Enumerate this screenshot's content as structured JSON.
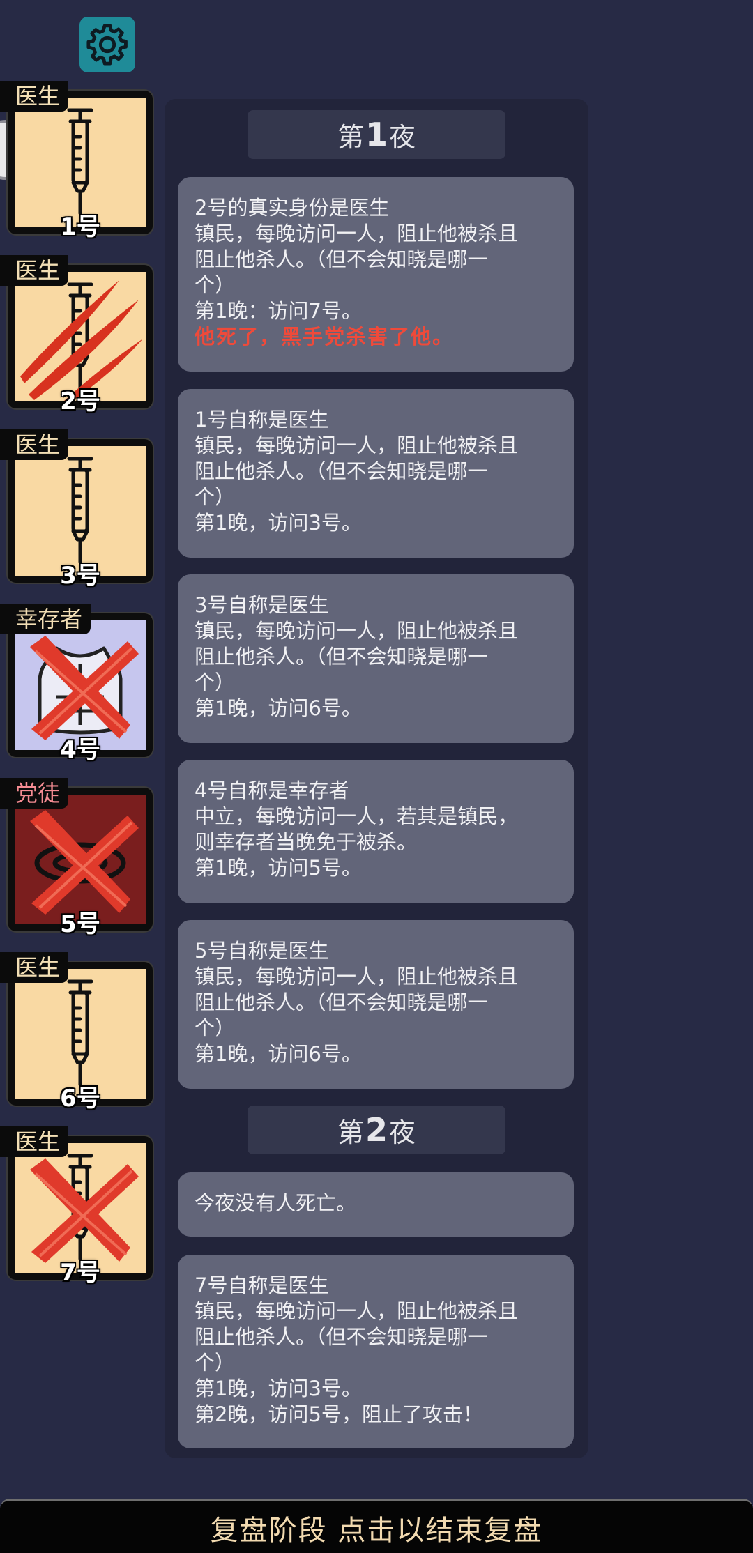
{
  "players": [
    {
      "role": "医生",
      "number": "1号",
      "icon": "syringe-icon",
      "state": "alive",
      "card_color": "#f9d9a3",
      "role_color": "#f3dfb5"
    },
    {
      "role": "医生",
      "number": "2号",
      "icon": "syringe-icon",
      "state": "clawed",
      "card_color": "#f9d9a3",
      "role_color": "#f3dfb5"
    },
    {
      "role": "医生",
      "number": "3号",
      "icon": "syringe-icon",
      "state": "alive",
      "card_color": "#f9d9a3",
      "role_color": "#f3dfb5"
    },
    {
      "role": "幸存者",
      "number": "4号",
      "icon": "vest-icon",
      "state": "crossed",
      "card_color": "#c6c6ee",
      "role_color": "#f3dfb5"
    },
    {
      "role": "党徒",
      "number": "5号",
      "icon": "cult-icon",
      "state": "crossed",
      "card_color": "#7a1e1e",
      "role_color": "#f58c93"
    },
    {
      "role": "医生",
      "number": "6号",
      "icon": "syringe-icon",
      "state": "alive",
      "card_color": "#f9d9a3",
      "role_color": "#f3dfb5"
    },
    {
      "role": "医生",
      "number": "7号",
      "icon": "syringe-icon",
      "state": "crossed",
      "card_color": "#f9d9a3",
      "role_color": "#f3dfb5"
    }
  ],
  "nights": [
    {
      "prefix": "第",
      "num": "1",
      "suffix": "夜"
    },
    {
      "prefix": "第",
      "num": "2",
      "suffix": "夜"
    }
  ],
  "entries": [
    {
      "lines": [
        "2号的真实身份是医生",
        "镇民，每晚访问一人，阻止他被杀且",
        "阻止他杀人。（但不会知晓是哪一",
        "个）",
        "第1晚：访问7号。"
      ],
      "death": "他死了，黑手党杀害了他。"
    },
    {
      "lines": [
        "1号自称是医生",
        "镇民，每晚访问一人，阻止他被杀且",
        "阻止他杀人。（但不会知晓是哪一",
        "个）",
        "第1晚，访问3号。"
      ]
    },
    {
      "lines": [
        "3号自称是医生",
        "镇民，每晚访问一人，阻止他被杀且",
        "阻止他杀人。（但不会知晓是哪一",
        "个）",
        "第1晚，访问6号。"
      ]
    },
    {
      "lines": [
        "4号自称是幸存者",
        "中立，每晚访问一人，若其是镇民，",
        "则幸存者当晚免于被杀。",
        "第1晚，访问5号。"
      ]
    },
    {
      "lines": [
        "5号自称是医生",
        "镇民，每晚访问一人，阻止他被杀且",
        "阻止他杀人。（但不会知晓是哪一",
        "个）",
        "第1晚，访问6号。"
      ]
    },
    {
      "lines": [
        "今夜没有人死亡。"
      ]
    },
    {
      "lines": [
        "7号自称是医生",
        "镇民，每晚访问一人，阻止他被杀且",
        "阻止他杀人。（但不会知晓是哪一",
        "个）",
        "第1晚，访问3号。",
        "第2晚，访问5号，阻止了攻击！"
      ]
    }
  ],
  "bottom_label": "复盘阶段 点击以结束复盘",
  "settings_icon": "gear-icon",
  "colors": {
    "accent": "#1f8b98",
    "death_text": "#ef4a3a",
    "panel": "#22243a",
    "entry": "#626579"
  }
}
